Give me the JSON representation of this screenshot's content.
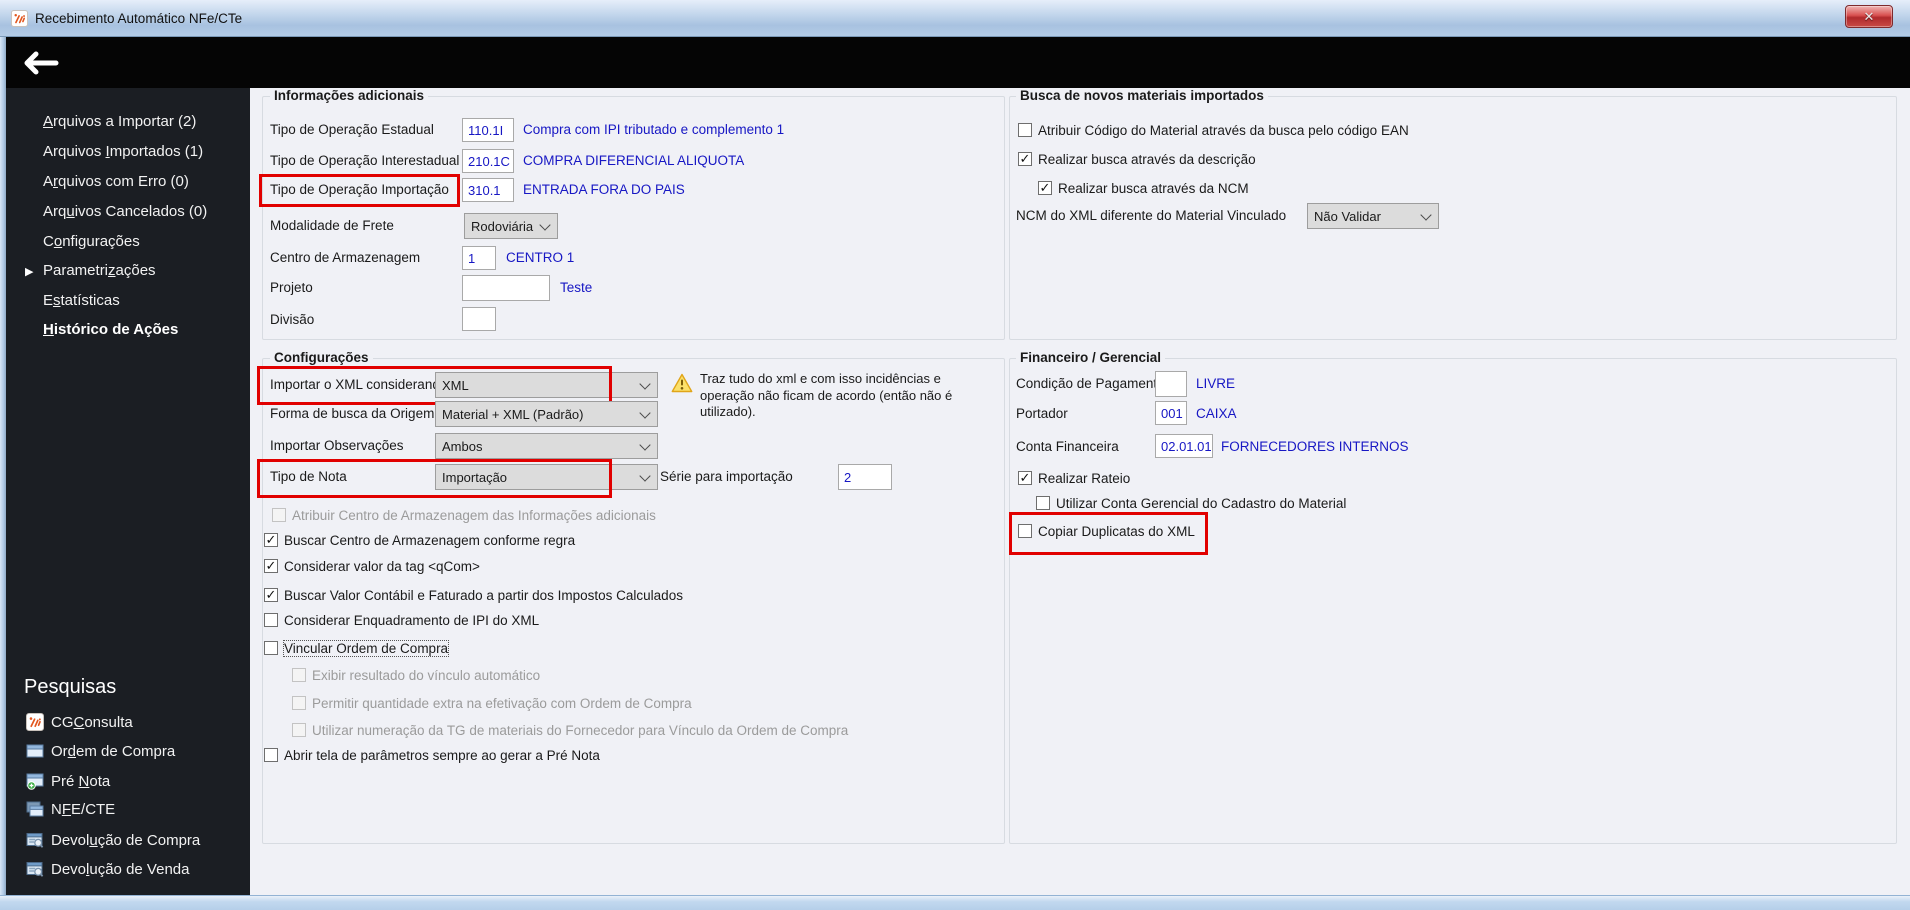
{
  "window": {
    "title": "Recebimento Automático NFe/CTe",
    "close_glyph": "✕"
  },
  "colors": {
    "highlight_red": "#e10000",
    "value_blue": "#1717c4",
    "sidebar_bg": "#1b1e23",
    "titlebar_blue": "#b3cbe6"
  },
  "nav": {
    "items": [
      {
        "pre": "",
        "accel": "A",
        "post": "rquivos a Importar (2)"
      },
      {
        "pre": "Arquivos ",
        "accel": "I",
        "post": "mportados (1)"
      },
      {
        "pre": "A",
        "accel": "r",
        "post": "quivos com Erro (0)"
      },
      {
        "pre": "Arq",
        "accel": "u",
        "post": "ivos Cancelados (0)"
      },
      {
        "pre": "C",
        "accel": "o",
        "post": "nfigurações"
      },
      {
        "pre": "Parametri",
        "accel": "z",
        "post": "ações",
        "expander": "▶"
      },
      {
        "pre": "E",
        "accel": "s",
        "post": "tatísticas"
      },
      {
        "pre": "",
        "accel": "H",
        "post": "istórico de Ações",
        "active": true
      }
    ]
  },
  "pesquisas": {
    "header": "Pesquisas",
    "items": [
      {
        "pre": "CG",
        "accel": "C",
        "post": "onsulta",
        "icon": "cgconsulta-icon"
      },
      {
        "pre": "Or",
        "accel": "d",
        "post": "em de Compra",
        "icon": "window-icon"
      },
      {
        "pre": "Pré ",
        "accel": "N",
        "post": "ota",
        "icon": "window-plus-icon"
      },
      {
        "pre": "N",
        "accel": "F",
        "post": "E/CTE",
        "icon": "windows-stack-icon"
      },
      {
        "pre": "Devol",
        "accel": "u",
        "post": "ção de Compra",
        "icon": "return-search-icon"
      },
      {
        "pre": "Devo",
        "accel": "l",
        "post": "ução de Venda",
        "icon": "return-search-icon"
      }
    ]
  },
  "info": {
    "caption": "Informações adicionais",
    "rows": [
      {
        "label": "Tipo de Operação Estadual",
        "value": "110.1I",
        "desc": "Compra com IPI tributado e complemento 1"
      },
      {
        "label": "Tipo de Operação Interestadual",
        "value": "210.1C",
        "desc": "COMPRA DIFERENCIAL ALIQUOTA"
      },
      {
        "label": "Tipo de Operação Importação",
        "value": "310.1",
        "desc": "ENTRADA FORA DO PAIS",
        "highlighted": true
      }
    ],
    "frete_label": "Modalidade de Frete",
    "frete_value": "Rodoviária",
    "centro_label": "Centro de Armazenagem",
    "centro_value": "1",
    "centro_desc": "CENTRO 1",
    "projeto_label": "Projeto",
    "projeto_value": "",
    "projeto_desc": "Teste",
    "divisao_label": "Divisão",
    "divisao_value": ""
  },
  "config": {
    "caption": "Configurações",
    "combos": [
      {
        "label": "Importar o XML considerando",
        "value": "XML",
        "highlighted": true
      },
      {
        "label": "Forma de busca da Origem",
        "value": "Material + XML (Padrão)"
      },
      {
        "label": "Importar Observações",
        "value": "Ambos"
      },
      {
        "label": "Tipo de Nota",
        "value": "Importação",
        "highlighted": true
      }
    ],
    "warning_text": "Traz tudo do xml e com isso incidências e operação não ficam de acordo (então não é utilizado).",
    "serie_label": "Série para importação",
    "serie_value": "2",
    "checkboxes": [
      {
        "label": "Atribuir Centro de Armazenagem das Informações adicionais",
        "state": "unchecked",
        "disabled": true
      },
      {
        "label": "Buscar Centro de Armazenagem conforme regra",
        "state": "checked"
      },
      {
        "label": "Considerar valor da tag <qCom>",
        "state": "checked"
      },
      {
        "label": "Buscar Valor Contábil e Faturado a partir dos Impostos Calculados",
        "state": "checked"
      },
      {
        "label": "Considerar Enquadramento de IPI do XML",
        "state": "unchecked"
      },
      {
        "label": "Vincular Ordem de Compra",
        "state": "unchecked",
        "focused": true
      },
      {
        "label": "Exibir resultado do vínculo automático",
        "state": "unchecked",
        "disabled": true
      },
      {
        "label": "Permitir quantidade extra na efetivação com Ordem de Compra",
        "state": "unchecked",
        "disabled": true
      },
      {
        "label": "Utilizar numeração da TG de materiais do Fornecedor para Vínculo da Ordem de Compra",
        "state": "unchecked",
        "disabled": true
      },
      {
        "label": "Abrir tela de parâmetros sempre ao gerar a Pré Nota",
        "state": "unchecked"
      }
    ]
  },
  "busca": {
    "caption": "Busca de novos materiais importados",
    "checkboxes": [
      {
        "label": "Atribuir Código do Material através da busca pelo código EAN",
        "state": "unchecked"
      },
      {
        "label": "Realizar busca através da descrição",
        "state": "checked"
      },
      {
        "label": "Realizar busca através da NCM",
        "state": "checked"
      }
    ],
    "ncm_label": "NCM do XML diferente do Material Vinculado",
    "ncm_value": "Não Validar"
  },
  "financeiro": {
    "caption": "Financeiro / Gerencial",
    "rows": [
      {
        "label": "Condição de Pagamento",
        "value": "",
        "desc": "LIVRE"
      },
      {
        "label": "Portador",
        "value": "001",
        "desc": "CAIXA"
      },
      {
        "label": "Conta Financeira",
        "value": "02.01.01",
        "desc": "FORNECEDORES INTERNOS"
      }
    ],
    "checkboxes": [
      {
        "label": "Realizar Rateio",
        "state": "checked"
      },
      {
        "label": "Utilizar Conta Gerencial do Cadastro do Material",
        "state": "unchecked"
      },
      {
        "label": "Copiar Duplicatas do XML",
        "state": "unchecked",
        "highlighted": true
      }
    ]
  }
}
